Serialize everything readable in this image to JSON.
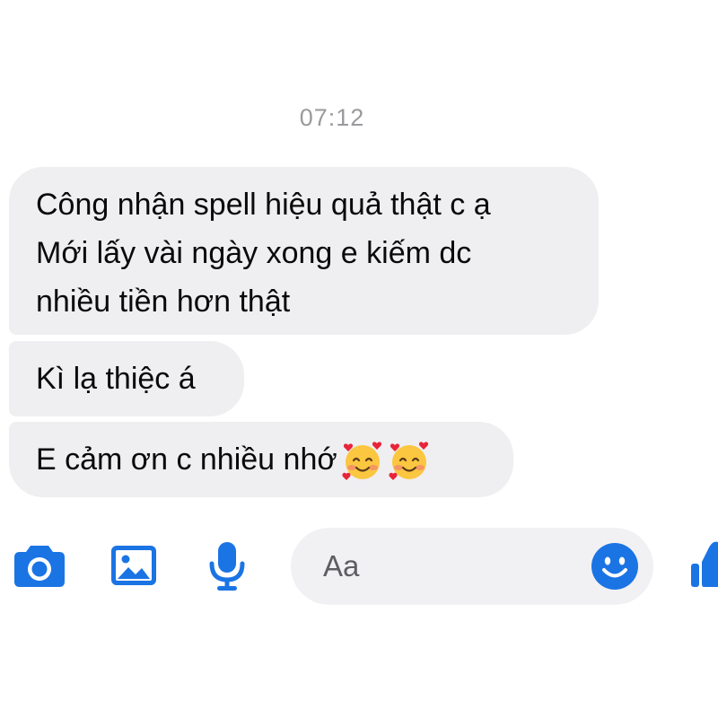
{
  "conversation": {
    "timestamp": "07:12",
    "messages": [
      {
        "lines": [
          "Công nhận spell hiệu quả thật c ạ",
          "Mới lấy vài ngày xong e kiếm dc",
          "nhiều tiền hơn thật"
        ]
      },
      {
        "lines": [
          "Kì lạ thiệc á"
        ]
      },
      {
        "lines": [
          "E cảm ơn c nhiều nhớ"
        ],
        "emojis": [
          "smiling-face-with-hearts",
          "smiling-face-with-hearts"
        ]
      }
    ]
  },
  "composer": {
    "placeholder": "Aa"
  },
  "toolbar": {
    "icons": [
      "camera-icon",
      "image-icon",
      "mic-icon",
      "emoji-icon",
      "like-icon"
    ]
  },
  "colors": {
    "accent": "#1b74e4",
    "bubble_bg": "#efeff1",
    "composer_bg": "#f1f1f3",
    "timestamp": "#9a9a9e",
    "text": "#0a0a0a"
  }
}
